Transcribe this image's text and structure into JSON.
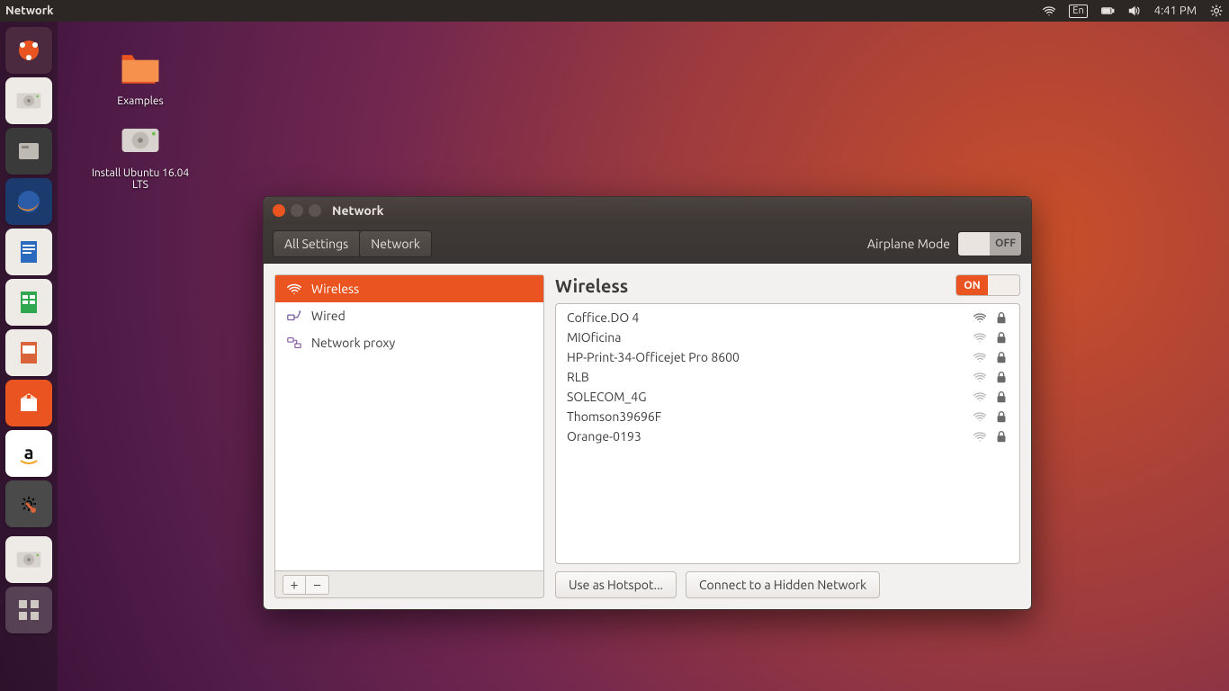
{
  "topbar": {
    "app_title": "Network",
    "lang": "En",
    "time": "4:41 PM"
  },
  "desktop_icons": [
    {
      "label": "Examples"
    },
    {
      "label": "Install Ubuntu 16.04 LTS"
    }
  ],
  "window": {
    "title": "Network",
    "breadcrumbs": {
      "all_settings": "All Settings",
      "network": "Network"
    },
    "airplane": {
      "label": "Airplane Mode",
      "state": "OFF"
    },
    "categories": [
      {
        "label": "Wireless",
        "active": true
      },
      {
        "label": "Wired",
        "active": false
      },
      {
        "label": "Network proxy",
        "active": false
      }
    ],
    "add_btn": "+",
    "remove_btn": "−",
    "detail": {
      "heading": "Wireless",
      "switch_state": "ON",
      "networks": [
        {
          "name": "Coffice.DO 4",
          "strength": 3,
          "locked": true
        },
        {
          "name": "MIOficina",
          "strength": 1,
          "locked": true
        },
        {
          "name": "HP-Print-34-Officejet Pro 8600",
          "strength": 1,
          "locked": true
        },
        {
          "name": "RLB",
          "strength": 1,
          "locked": true
        },
        {
          "name": "SOLECOM_4G",
          "strength": 1,
          "locked": true
        },
        {
          "name": "Thomson39696F",
          "strength": 1,
          "locked": true
        },
        {
          "name": "Orange-0193",
          "strength": 1,
          "locked": true
        }
      ],
      "hotspot_btn": "Use as Hotspot...",
      "hidden_btn": "Connect to a Hidden Network"
    }
  }
}
